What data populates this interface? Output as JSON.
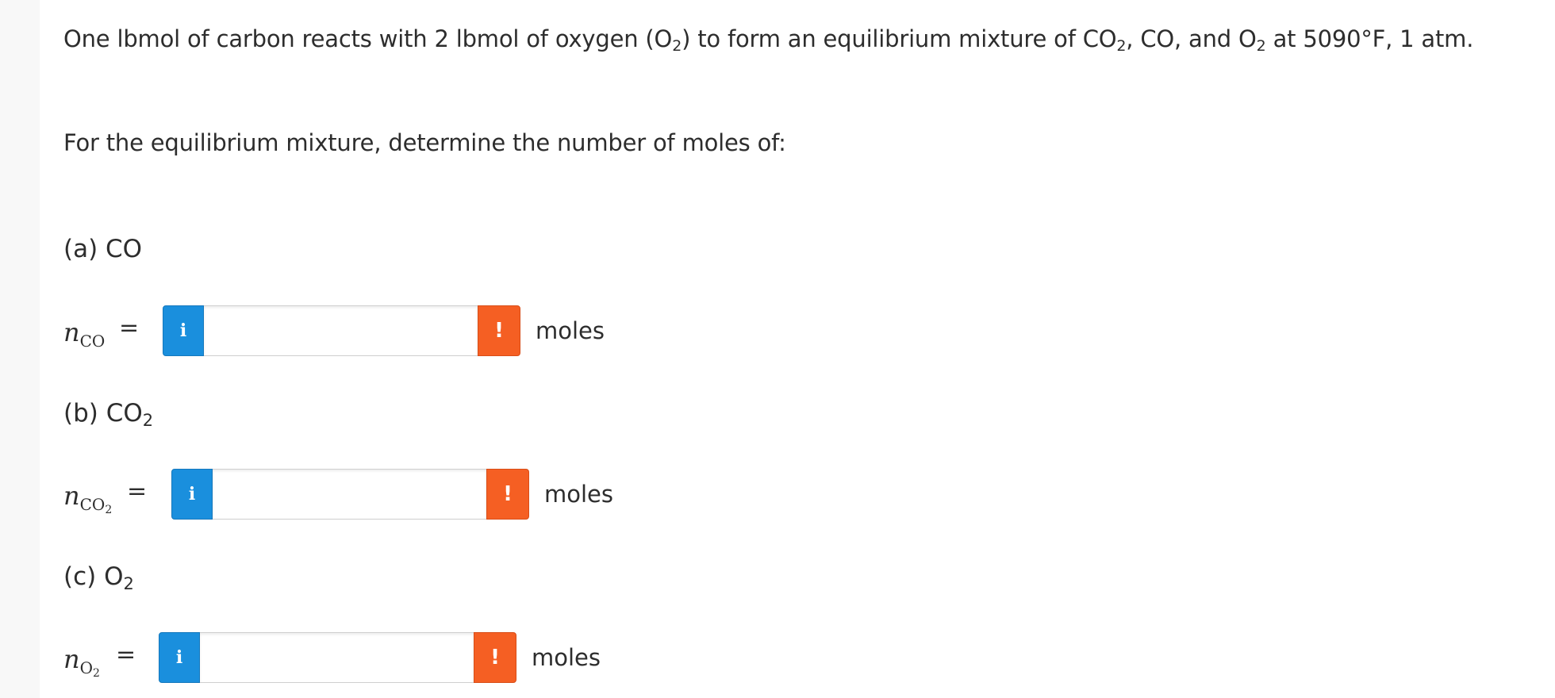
{
  "problem": {
    "statement_parts": [
      "One lbmol of carbon reacts with 2 lbmol of oxygen (O",
      "2",
      ") to form an equilibrium mixture of CO",
      "2",
      ", CO, and O",
      "2",
      " at 5090°F, 1 atm."
    ],
    "instruction": "For the equilibrium mixture, determine the number of moles of:"
  },
  "parts": [
    {
      "label": "(a) CO",
      "variable": {
        "symbol": "n",
        "subscript": "CO",
        "subscript_sub": ""
      },
      "equals": "=",
      "info_icon": "i",
      "warning_icon": "!",
      "value": "",
      "placeholder": "",
      "unit": "moles"
    },
    {
      "label": "(b) CO",
      "label_sub": "2",
      "variable": {
        "symbol": "n",
        "subscript": "CO",
        "subscript_sub": "2"
      },
      "equals": "=",
      "info_icon": "i",
      "warning_icon": "!",
      "value": "",
      "placeholder": "",
      "unit": "moles"
    },
    {
      "label": "(c) O",
      "label_sub": "2",
      "variable": {
        "symbol": "n",
        "subscript": "O",
        "subscript_sub": "2"
      },
      "equals": "=",
      "info_icon": "i",
      "warning_icon": "!",
      "value": "",
      "placeholder": "",
      "unit": "moles"
    }
  ],
  "colors": {
    "info_button": "#1a8fdd",
    "warning_button": "#f55f23",
    "text": "#2d2d2d",
    "page_background": "#ffffff",
    "margin_background": "#f8f8f8"
  },
  "icons": {
    "info": "info-icon",
    "warning": "warning-icon"
  }
}
